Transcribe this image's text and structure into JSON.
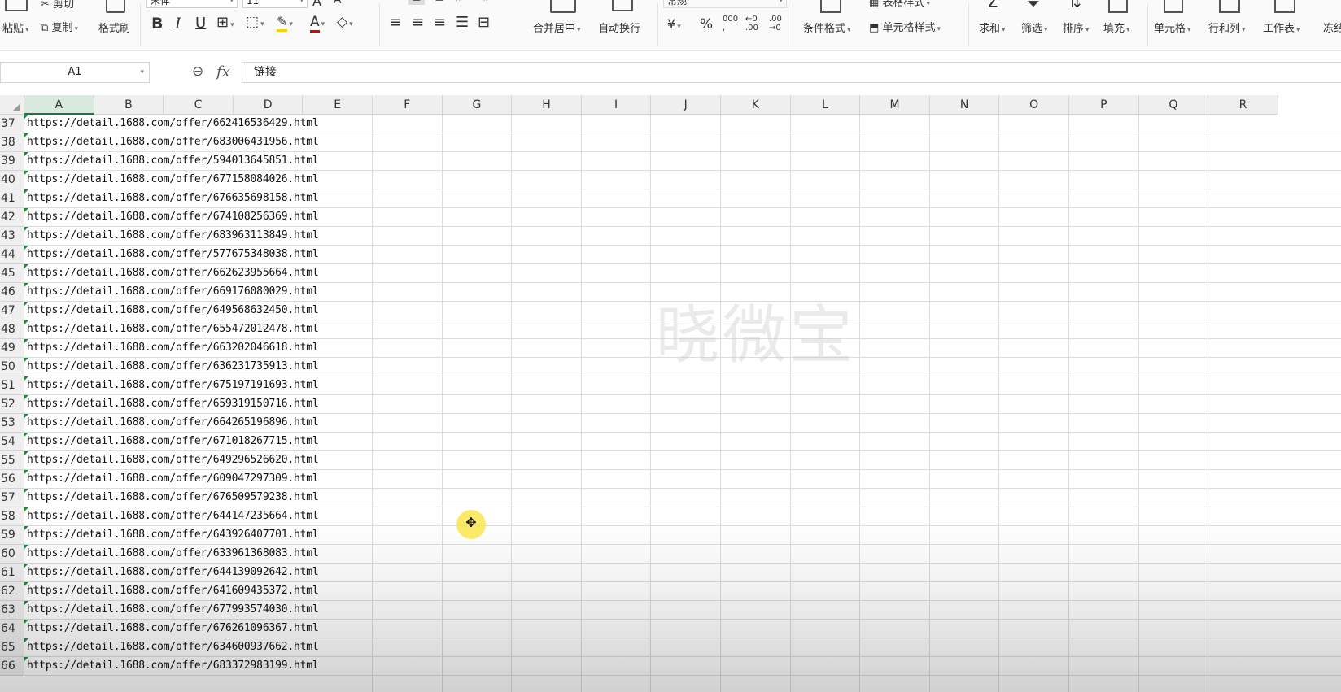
{
  "ribbon": {
    "clipboard": {
      "paste": "粘贴",
      "cut": "剪切",
      "copy": "复制",
      "format_painter": "格式刷"
    },
    "font": {
      "name": "宋体",
      "size": "11"
    },
    "align": {
      "merge_center": "合并居中",
      "wrap_text": "自动换行"
    },
    "number": {
      "format": "常规",
      "currency": "¥",
      "percent": "%",
      "thousands": "000",
      "inc_decimal": ".00",
      "dec_decimal": ".00"
    },
    "styles": {
      "conditional_format": "条件格式",
      "table_style": "表格样式",
      "cell_style": "单元格样式"
    },
    "edit": {
      "sum": "求和",
      "filter": "筛选",
      "sort": "排序",
      "fill": "填充",
      "cell": "单元格",
      "row_col": "行和列",
      "worksheet": "工作表",
      "freeze": "冻结"
    }
  },
  "formula_bar": {
    "name_box": "A1",
    "fx": "fx",
    "content": "链接"
  },
  "columns": [
    "A",
    "B",
    "C",
    "D",
    "E",
    "F",
    "G",
    "H",
    "I",
    "J",
    "K",
    "L",
    "M",
    "N",
    "O",
    "P",
    "Q",
    "R"
  ],
  "rows": [
    {
      "num": "37",
      "value": "https://detail.1688.com/offer/662416536429.html"
    },
    {
      "num": "38",
      "value": "https://detail.1688.com/offer/683006431956.html"
    },
    {
      "num": "39",
      "value": "https://detail.1688.com/offer/594013645851.html"
    },
    {
      "num": "40",
      "value": "https://detail.1688.com/offer/677158084026.html"
    },
    {
      "num": "41",
      "value": "https://detail.1688.com/offer/676635698158.html"
    },
    {
      "num": "42",
      "value": "https://detail.1688.com/offer/674108256369.html"
    },
    {
      "num": "43",
      "value": "https://detail.1688.com/offer/683963113849.html"
    },
    {
      "num": "44",
      "value": "https://detail.1688.com/offer/577675348038.html"
    },
    {
      "num": "45",
      "value": "https://detail.1688.com/offer/662623955664.html"
    },
    {
      "num": "46",
      "value": "https://detail.1688.com/offer/669176080029.html"
    },
    {
      "num": "47",
      "value": "https://detail.1688.com/offer/649568632450.html"
    },
    {
      "num": "48",
      "value": "https://detail.1688.com/offer/655472012478.html"
    },
    {
      "num": "49",
      "value": "https://detail.1688.com/offer/663202046618.html"
    },
    {
      "num": "50",
      "value": "https://detail.1688.com/offer/636231735913.html"
    },
    {
      "num": "51",
      "value": "https://detail.1688.com/offer/675197191693.html"
    },
    {
      "num": "52",
      "value": "https://detail.1688.com/offer/659319150716.html"
    },
    {
      "num": "53",
      "value": "https://detail.1688.com/offer/664265196896.html"
    },
    {
      "num": "54",
      "value": "https://detail.1688.com/offer/671018267715.html"
    },
    {
      "num": "55",
      "value": "https://detail.1688.com/offer/649296526620.html"
    },
    {
      "num": "56",
      "value": "https://detail.1688.com/offer/609047297309.html"
    },
    {
      "num": "57",
      "value": "https://detail.1688.com/offer/676509579238.html"
    },
    {
      "num": "58",
      "value": "https://detail.1688.com/offer/644147235664.html"
    },
    {
      "num": "59",
      "value": "https://detail.1688.com/offer/643926407701.html"
    },
    {
      "num": "60",
      "value": "https://detail.1688.com/offer/633961368083.html"
    },
    {
      "num": "61",
      "value": "https://detail.1688.com/offer/644139092642.html"
    },
    {
      "num": "62",
      "value": "https://detail.1688.com/offer/641609435372.html"
    },
    {
      "num": "63",
      "value": "https://detail.1688.com/offer/677993574030.html"
    },
    {
      "num": "64",
      "value": "https://detail.1688.com/offer/676261096367.html"
    },
    {
      "num": "65",
      "value": "https://detail.1688.com/offer/634600937662.html"
    },
    {
      "num": "66",
      "value": "https://detail.1688.com/offer/683372983199.html"
    }
  ],
  "watermark": "晓微宝",
  "colors": {
    "selected_header": "#d9e9dd",
    "accent": "#217346",
    "cursor_highlight": "#fae650"
  }
}
